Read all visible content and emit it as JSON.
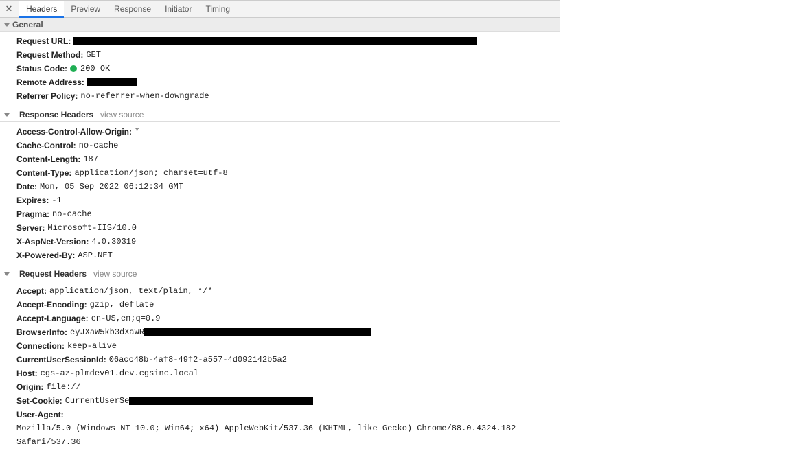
{
  "tabs": {
    "headers": "Headers",
    "preview": "Preview",
    "response": "Response",
    "initiator": "Initiator",
    "timing": "Timing"
  },
  "sections": {
    "general": "General",
    "responseHeaders": "Response Headers",
    "requestHeaders": "Request Headers",
    "viewSource": "view source"
  },
  "general": {
    "requestUrl_k": "Request URL:",
    "requestMethod_k": "Request Method:",
    "requestMethod_v": "GET",
    "statusCode_k": "Status Code:",
    "statusCode_v": "200 OK",
    "remoteAddress_k": "Remote Address:",
    "referrerPolicy_k": "Referrer Policy:",
    "referrerPolicy_v": "no-referrer-when-downgrade"
  },
  "responseHeaders": [
    {
      "k": "Access-Control-Allow-Origin:",
      "v": "*"
    },
    {
      "k": "Cache-Control:",
      "v": "no-cache"
    },
    {
      "k": "Content-Length:",
      "v": "187"
    },
    {
      "k": "Content-Type:",
      "v": "application/json; charset=utf-8"
    },
    {
      "k": "Date:",
      "v": "Mon, 05 Sep 2022 06:12:34 GMT"
    },
    {
      "k": "Expires:",
      "v": "-1"
    },
    {
      "k": "Pragma:",
      "v": "no-cache"
    },
    {
      "k": "Server:",
      "v": "Microsoft-IIS/10.0"
    },
    {
      "k": "X-AspNet-Version:",
      "v": "4.0.30319"
    },
    {
      "k": "X-Powered-By:",
      "v": "ASP.NET"
    }
  ],
  "requestHeaders": {
    "accept_k": "Accept:",
    "accept_v": "application/json, text/plain, */*",
    "acceptEnc_k": "Accept-Encoding:",
    "acceptEnc_v": "gzip, deflate",
    "acceptLang_k": "Accept-Language:",
    "acceptLang_v": "en-US,en;q=0.9",
    "browserInfo_k": "BrowserInfo:",
    "browserInfo_v": "eyJXaW5kb3dXaWR",
    "connection_k": "Connection:",
    "connection_v": "keep-alive",
    "sessionId_k": "CurrentUserSessionId:",
    "sessionId_v": "06acc48b-4af8-49f2-a557-4d092142b5a2",
    "host_k": "Host:",
    "host_v": "cgs-az-plmdev01.dev.cgsinc.local",
    "origin_k": "Origin:",
    "origin_v": "file://",
    "setCookie_k": "Set-Cookie:",
    "setCookie_v": "CurrentUserSe",
    "ua_k": "User-Agent:",
    "ua_v": "Mozilla/5.0 (Windows NT 10.0; Win64; x64) AppleWebKit/537.36 (KHTML, like Gecko) Chrome/88.0.4324.182 Safari/537.36"
  }
}
